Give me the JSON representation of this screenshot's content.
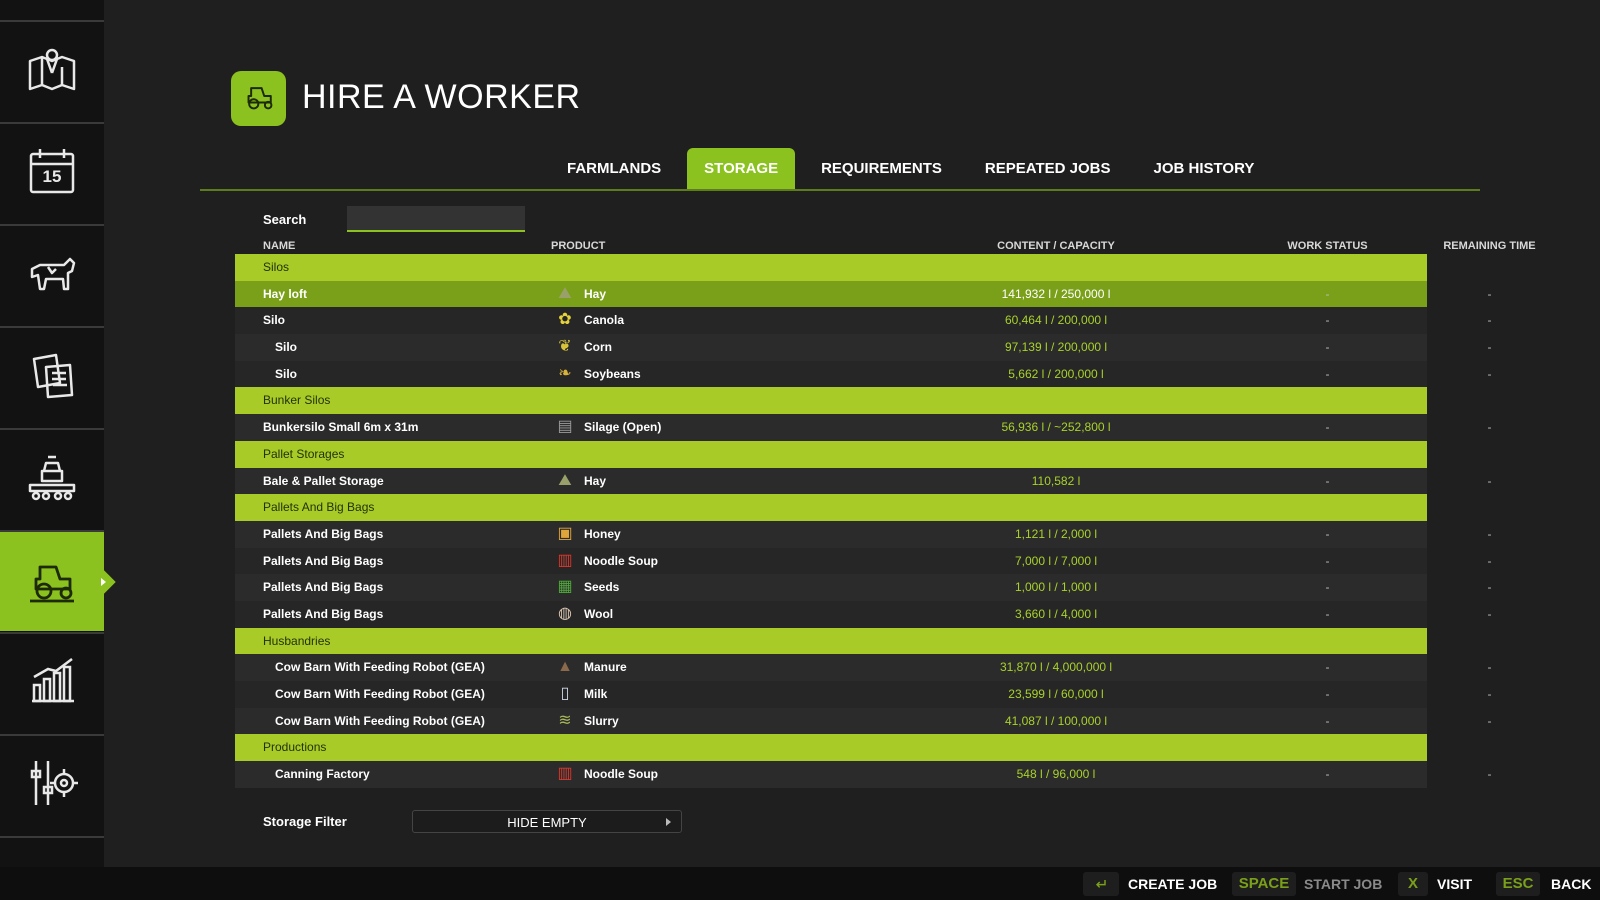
{
  "sidebar": {
    "items": [
      {
        "icon": "map-icon"
      },
      {
        "icon": "calendar-icon",
        "label": "15"
      },
      {
        "icon": "cow-icon"
      },
      {
        "icon": "documents-icon"
      },
      {
        "icon": "production-icon"
      },
      {
        "icon": "tractor-icon",
        "active": true
      },
      {
        "icon": "statistics-icon"
      },
      {
        "icon": "settings-icon"
      }
    ]
  },
  "header": {
    "title": "HIRE A WORKER",
    "icon": "tractor-icon"
  },
  "tabs": [
    "FARMLANDS",
    "STORAGE",
    "REQUIREMENTS",
    "REPEATED JOBS",
    "JOB HISTORY"
  ],
  "active_tab": "STORAGE",
  "search": {
    "label": "Search",
    "value": ""
  },
  "table": {
    "columns": [
      "NAME",
      "PRODUCT",
      "CONTENT / CAPACITY",
      "WORK STATUS",
      "REMAINING TIME"
    ],
    "rows": [
      {
        "type": "group",
        "name": "Silos"
      },
      {
        "type": "item",
        "name": "Hay loft",
        "icon": "hay-icon",
        "product": "Hay",
        "content": "141,932 l / 250,000 l",
        "status": "-",
        "remaining": "-",
        "selected": true
      },
      {
        "type": "item",
        "name": "Silo",
        "icon": "canola-icon",
        "product": "Canola",
        "content": "60,464 l / 200,000 l",
        "status": "-",
        "remaining": "-"
      },
      {
        "type": "item",
        "name": "Silo",
        "indent": true,
        "icon": "corn-icon",
        "product": "Corn",
        "content": "97,139 l / 200,000 l",
        "status": "-",
        "remaining": "-"
      },
      {
        "type": "item",
        "name": "Silo",
        "indent": true,
        "icon": "soybeans-icon",
        "product": "Soybeans",
        "content": "5,662 l / 200,000 l",
        "status": "-",
        "remaining": "-"
      },
      {
        "type": "group",
        "name": "Bunker Silos"
      },
      {
        "type": "item",
        "name": "Bunkersilo Small 6m x 31m",
        "icon": "silage-icon",
        "product": "Silage (Open)",
        "content": "56,936 l / ~252,800 l",
        "status": "-",
        "remaining": "-"
      },
      {
        "type": "group",
        "name": "Pallet Storages"
      },
      {
        "type": "item",
        "name": "Bale & Pallet Storage",
        "icon": "hay-icon",
        "product": "Hay",
        "content": "110,582 l",
        "status": "-",
        "remaining": "-"
      },
      {
        "type": "group",
        "name": "Pallets And Big Bags"
      },
      {
        "type": "item",
        "name": "Pallets And Big Bags",
        "icon": "honey-icon",
        "product": "Honey",
        "content": "1,121 l / 2,000 l",
        "status": "-",
        "remaining": "-"
      },
      {
        "type": "item",
        "name": "Pallets And Big Bags",
        "icon": "noodle-soup-icon",
        "product": "Noodle Soup",
        "content": "7,000 l / 7,000 l",
        "status": "-",
        "remaining": "-"
      },
      {
        "type": "item",
        "name": "Pallets And Big Bags",
        "icon": "seeds-icon",
        "product": "Seeds",
        "content": "1,000 l / 1,000 l",
        "status": "-",
        "remaining": "-"
      },
      {
        "type": "item",
        "name": "Pallets And Big Bags",
        "icon": "wool-icon",
        "product": "Wool",
        "content": "3,660 l / 4,000 l",
        "status": "-",
        "remaining": "-"
      },
      {
        "type": "group",
        "name": "Husbandries"
      },
      {
        "type": "item",
        "name": "Cow Barn With Feeding Robot (GEA)",
        "indent": true,
        "icon": "manure-icon",
        "product": "Manure",
        "content": "31,870 l / 4,000,000 l",
        "status": "-",
        "remaining": "-"
      },
      {
        "type": "item",
        "name": "Cow Barn With Feeding Robot (GEA)",
        "indent": true,
        "icon": "milk-icon",
        "product": "Milk",
        "content": "23,599 l / 60,000 l",
        "status": "-",
        "remaining": "-"
      },
      {
        "type": "item",
        "name": "Cow Barn With Feeding Robot (GEA)",
        "indent": true,
        "icon": "slurry-icon",
        "product": "Slurry",
        "content": "41,087 l / 100,000 l",
        "status": "-",
        "remaining": "-"
      },
      {
        "type": "group",
        "name": "Productions"
      },
      {
        "type": "item",
        "name": "Canning Factory",
        "indent": true,
        "icon": "noodle-soup-icon",
        "product": "Noodle Soup",
        "content": "548 l / 96,000 l",
        "status": "-",
        "remaining": "-"
      }
    ]
  },
  "storage_filter": {
    "label": "Storage Filter",
    "value": "HIDE EMPTY"
  },
  "bottom_bar": {
    "create_job": {
      "key_icon": "enter-icon",
      "label": "CREATE JOB"
    },
    "start_job": {
      "key": "SPACE",
      "label": "START JOB"
    },
    "visit": {
      "key": "X",
      "label": "VISIT"
    },
    "back": {
      "key": "ESC",
      "label": "BACK"
    }
  },
  "colors": {
    "accent": "#8cc21f",
    "group_row": "#a9cb27",
    "selected_row": "#7aa01a",
    "content_text": "#a8d22a",
    "background": "#1f1f1f"
  }
}
